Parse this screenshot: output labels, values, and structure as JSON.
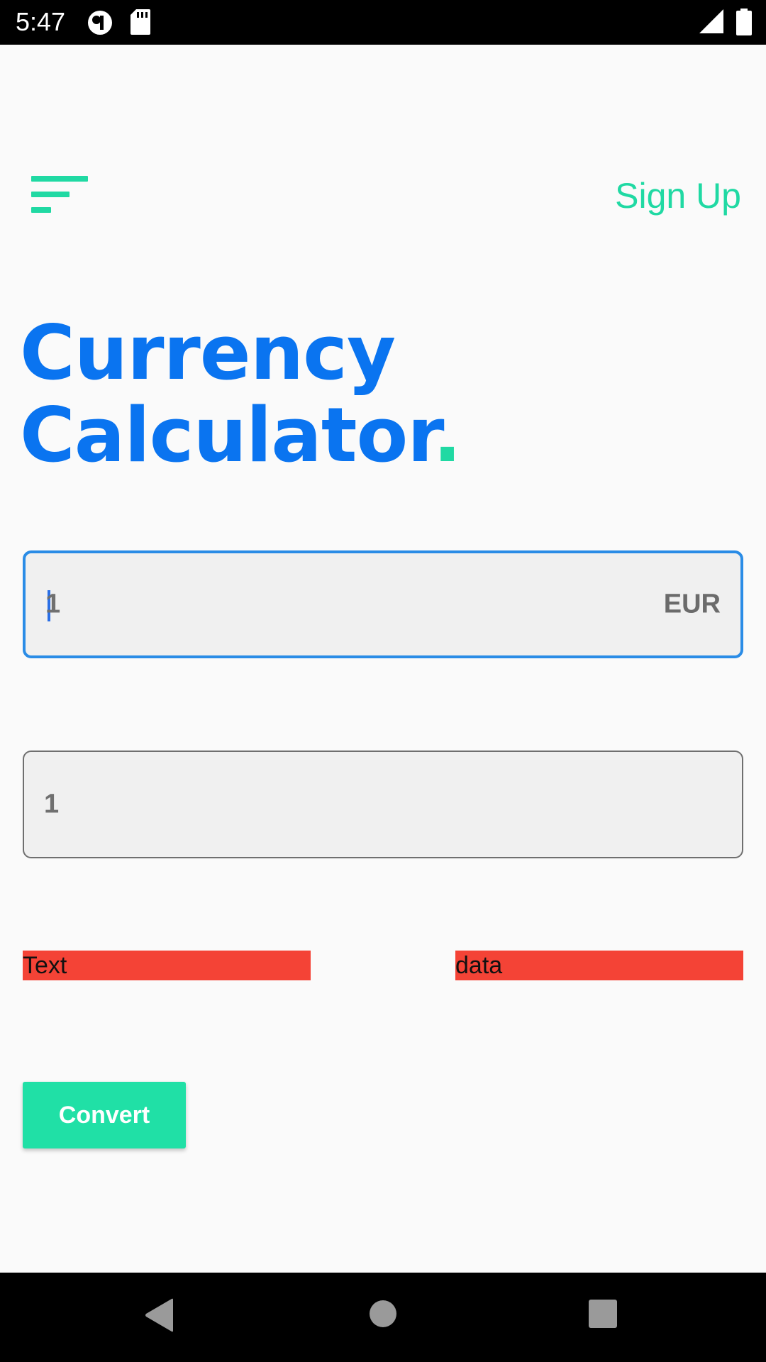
{
  "status_bar": {
    "time": "5:47",
    "icons": [
      "notification-circle-icon",
      "sd-card-icon",
      "signal-icon",
      "battery-icon"
    ]
  },
  "header": {
    "menu_icon": "hamburger-menu-icon",
    "signup_label": "Sign Up"
  },
  "title": {
    "line1": "Currency",
    "line2": "Calculator",
    "dot": "."
  },
  "amount_field": {
    "value": "1",
    "currency": "EUR"
  },
  "result_field": {
    "value": "1"
  },
  "info": {
    "left_text": "Text",
    "right_text": "data"
  },
  "convert_button": {
    "label": "Convert"
  },
  "nav_bar": {
    "icons": [
      "back-icon",
      "home-icon",
      "recents-icon"
    ]
  },
  "colors": {
    "accent_green": "#20d9a3",
    "title_blue": "#0a74f0",
    "focus_blue": "#2a8ce6",
    "error_red": "#f44336"
  }
}
